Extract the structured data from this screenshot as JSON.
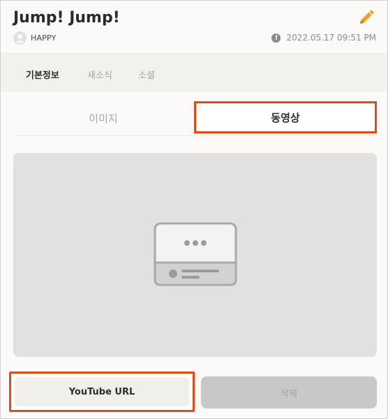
{
  "header": {
    "title": "Jump! Jump!",
    "username": "HAPPY",
    "datetime": "2022.05.17 09:51 PM",
    "edit_icon": "pencil-icon",
    "alert_icon": "exclamation-icon",
    "accent_color": "#f0a020"
  },
  "nav": {
    "items": [
      {
        "label": "기본정보",
        "active": true
      },
      {
        "label": "새소식",
        "active": false
      },
      {
        "label": "소셜",
        "active": false
      }
    ]
  },
  "tabs": [
    {
      "label": "이미지",
      "active": false
    },
    {
      "label": "동영상",
      "active": true
    }
  ],
  "preview": {
    "icon": "video-placeholder-icon"
  },
  "buttons": {
    "youtube_label": "YouTube URL",
    "delete_label": "삭제",
    "highlight_color": "#e44b12"
  }
}
